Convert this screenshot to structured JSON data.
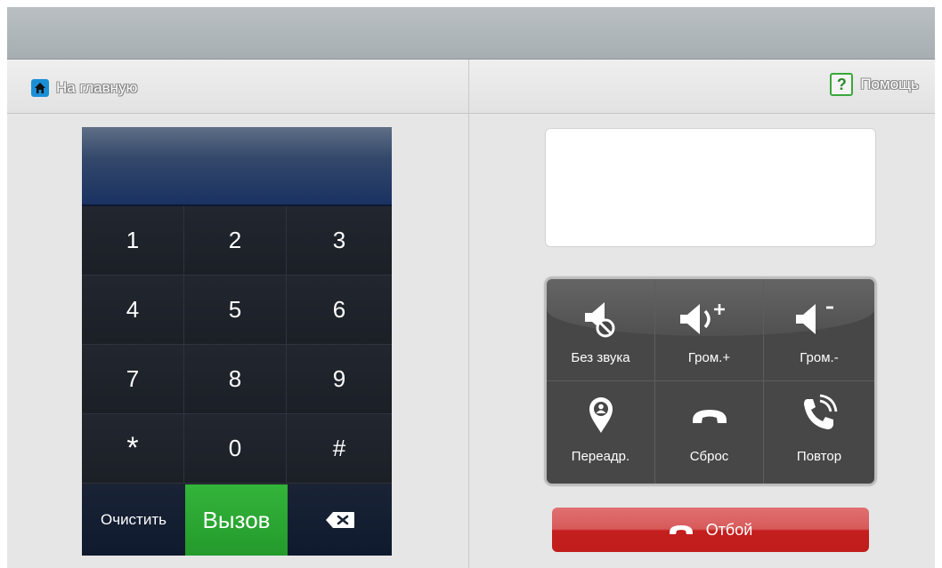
{
  "nav": {
    "home_label": "На главную",
    "help_label": "Помощь",
    "help_icon_text": "?"
  },
  "keypad": {
    "keys": [
      "1",
      "2",
      "3",
      "4",
      "5",
      "6",
      "7",
      "8",
      "9",
      "*",
      "0",
      "#"
    ],
    "clear_label": "Очистить",
    "call_label": "Вызов"
  },
  "controls": {
    "mute_label": "Без звука",
    "vol_up_label": "Гром.+",
    "vol_down_label": "Гром.-",
    "forward_label": "Переадр.",
    "reset_label": "Сброс",
    "redial_label": "Повтор"
  },
  "hangup_label": "Отбой",
  "colors": {
    "call_green": "#2ca834",
    "hangup_red": "#c41e1e",
    "home_blue": "#1a8fd6",
    "help_green": "#3aa83a"
  },
  "icons": [
    "home-icon",
    "help-icon",
    "backspace-icon",
    "mute-icon",
    "volume-up-icon",
    "volume-down-icon",
    "forward-location-icon",
    "phone-reset-icon",
    "phone-redial-icon",
    "phone-hangup-icon"
  ]
}
